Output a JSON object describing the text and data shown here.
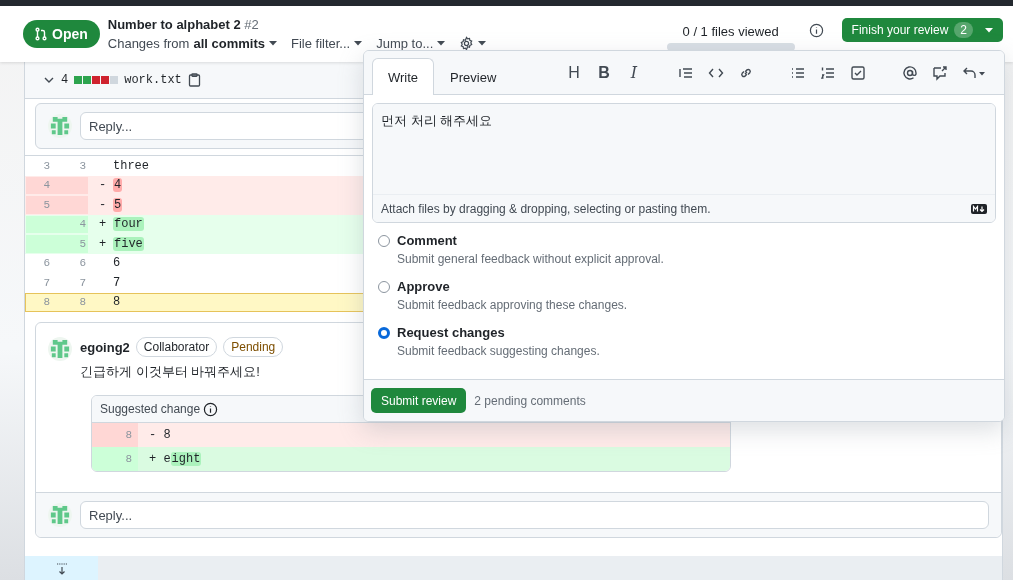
{
  "header": {
    "status": "Open",
    "title": "Number to alphabet 2",
    "number": "#2",
    "changes_from": "Changes from",
    "changes_scope": "all commits",
    "file_filter": "File filter...",
    "jump_to": "Jump to...",
    "files_viewed": "0 / 1 files viewed",
    "files_progress": {
      "level": 0
    },
    "finish_review": "Finish your review",
    "finish_count": "2"
  },
  "file": {
    "changes": "4",
    "diffstat": [
      {
        "color": "#2da44e"
      },
      {
        "color": "#2da44e"
      },
      {
        "color": "#cf222e"
      },
      {
        "color": "#cf222e"
      },
      {
        "color": "#d0d7de"
      }
    ],
    "name": "work.txt",
    "reply_placeholder": "Reply..."
  },
  "diff": {
    "lines": [
      {
        "kind": "context",
        "old": "3",
        "new": "3",
        "text": "three",
        "selected": false
      },
      {
        "kind": "deletion",
        "old": "4",
        "sign": "-",
        "marked": "4",
        "selected": false
      },
      {
        "kind": "deletion",
        "old": "5",
        "sign": "-",
        "marked": "5",
        "selected": false
      },
      {
        "kind": "addition",
        "new": "4",
        "sign": "+",
        "marked": "four",
        "selected": false
      },
      {
        "kind": "addition",
        "new": "5",
        "sign": "+",
        "marked": "five",
        "selected": false
      },
      {
        "kind": "context",
        "old": "6",
        "new": "6",
        "text": "6",
        "selected": false
      },
      {
        "kind": "context",
        "old": "7",
        "new": "7",
        "text": "7",
        "selected": false
      },
      {
        "kind": "context",
        "old": "8",
        "new": "8",
        "text": "8",
        "selected": true
      }
    ]
  },
  "comment": {
    "author": "egoing2",
    "badges": [
      {
        "kind": "role",
        "label": "Collaborator"
      },
      {
        "kind": "pending",
        "label": "Pending"
      }
    ],
    "body": "긴급하게 이것부터 바꿔주세요!",
    "suggestion_title": "Suggested change",
    "suggestion_lines": [
      {
        "kind": "deletion",
        "num": "8",
        "sign": "-",
        "text": "8"
      },
      {
        "kind": "addition",
        "num": "8",
        "sign": "+",
        "text": "e",
        "marked": "ight"
      }
    ],
    "reply_placeholder": "Reply..."
  },
  "popover": {
    "tabs": [
      {
        "label": "Write",
        "selected": true
      },
      {
        "label": "Preview",
        "selected": false
      }
    ],
    "toolbar_text": [
      {
        "kind": "heading",
        "label": "H"
      },
      {
        "kind": "bold",
        "label": "B"
      },
      {
        "kind": "italic",
        "label": "I"
      }
    ],
    "body": "먼저 처리 해주세요",
    "attach_hint": "Attach files by dragging & dropping, selecting or pasting them.",
    "options": [
      {
        "label": "Comment",
        "description": "Submit general feedback without explicit approval.",
        "selected": false
      },
      {
        "label": "Approve",
        "description": "Submit feedback approving these changes.",
        "selected": false
      },
      {
        "label": "Request changes",
        "description": "Submit feedback suggesting changes.",
        "selected": true
      }
    ],
    "submit": "Submit review",
    "pending": "2 pending comments"
  }
}
